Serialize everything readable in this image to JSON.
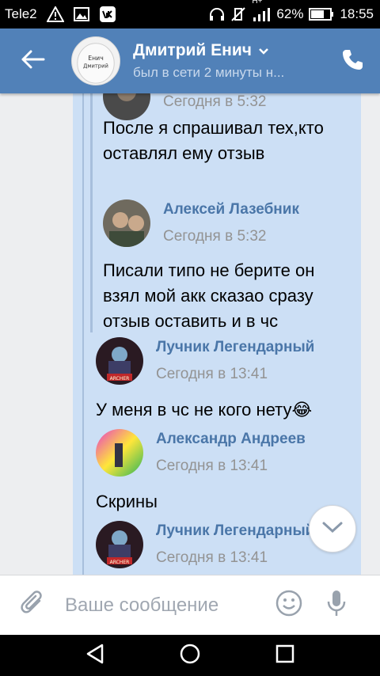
{
  "status_bar": {
    "carrier": "Tele2",
    "network_type": "H+",
    "battery": "62%",
    "time": "18:55"
  },
  "header": {
    "name": "Дмитрий Енич",
    "status": "был в сети 2 минуты н...",
    "avatar_text_line1": "Енич",
    "avatar_text_line2": "Дмитрий"
  },
  "messages": [
    {
      "type": "time_only",
      "time": "Сегодня в 5:32"
    },
    {
      "type": "text",
      "text": "После я спрашивал тех,кто оставлял ему отзыв"
    },
    {
      "type": "author",
      "name": "Алексей Лазебник",
      "time": "Сегодня в 5:32"
    },
    {
      "type": "text",
      "text": "Писали типо не берите он взял мой акк сказао сразу отзыв оставить и в чс"
    },
    {
      "type": "author",
      "name": "Лучник Легендарный",
      "time": "Сегодня в 13:41"
    },
    {
      "type": "text",
      "text": "У меня в чс не кого нету",
      "emoji": "😂"
    },
    {
      "type": "author",
      "name": "Александр Андреев",
      "time": "Сегодня в 13:41"
    },
    {
      "type": "text",
      "text": "Скрины"
    },
    {
      "type": "author",
      "name": "Лучник Легендарный",
      "time": "Сегодня в 13:41"
    }
  ],
  "avatar_badge": "ARCHER",
  "composer": {
    "placeholder": "Ваше сообщение"
  },
  "colors": {
    "header_bg": "#5181b8",
    "bubble_bg": "#ccdff5",
    "author_name": "#4a76a8",
    "chat_bg": "#edeef0"
  },
  "icons": {
    "back": "arrow-left-icon",
    "call": "phone-icon",
    "attach": "paperclip-icon",
    "emoji": "smiley-icon",
    "mic": "microphone-icon",
    "scroll": "chevron-down-icon"
  }
}
